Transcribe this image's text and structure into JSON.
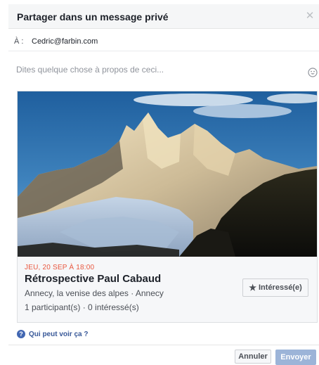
{
  "dialog": {
    "title": "Partager dans un message privé",
    "close_icon": "close-icon"
  },
  "recipient": {
    "label": "À :",
    "value": "Cedric@farbin.com"
  },
  "message": {
    "placeholder": "Dites quelque chose à propos de ceci...",
    "value": "",
    "emoji_icon": "emoji-icon"
  },
  "event": {
    "image": "mountain-photo",
    "date": "JEU, 20 SEP À 18:00",
    "title": "Rétrospective Paul Cabaud",
    "location": "Annecy, la venise des alpes · Annecy",
    "stats": "1 participant(s) · 0 intéressé(s)",
    "interest_label": "Intéressé(e)",
    "interest_icon": "star-icon"
  },
  "privacy": {
    "icon": "help-icon",
    "label": "Qui peut voir ça ?"
  },
  "footer": {
    "cancel_label": "Annuler",
    "send_label": "Envoyer"
  },
  "colors": {
    "accent": "#4267b2",
    "link": "#385898",
    "date_red": "#e9573f",
    "send_disabled": "#9cb4d8",
    "header_bg": "#f5f6f7"
  }
}
